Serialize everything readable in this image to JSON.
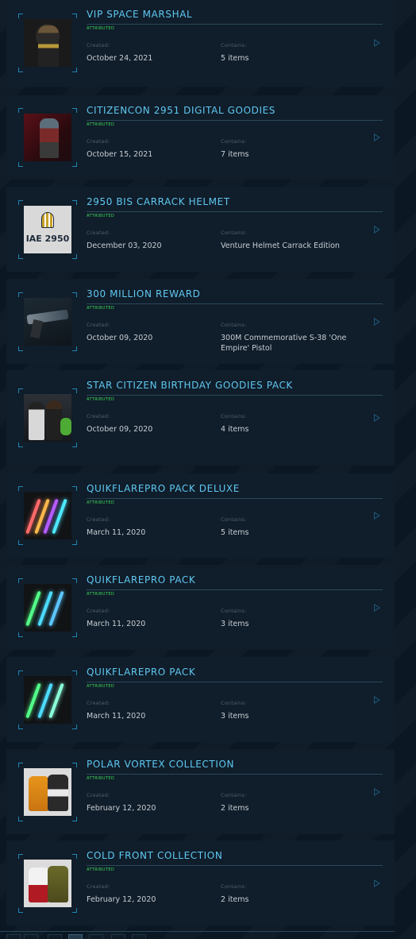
{
  "items": [
    {
      "title": "VIP SPACE MARSHAL",
      "status": "ATTRIBUTED",
      "created_label": "Created:",
      "created": "October 24, 2021",
      "contains_label": "Contains:",
      "contains": "5 items",
      "thumb": "marshal"
    },
    {
      "title": "CITIZENCON 2951 DIGITAL GOODIES",
      "status": "ATTRIBUTED",
      "created_label": "Created:",
      "created": "October 15, 2021",
      "contains_label": "Contains:",
      "contains": "7 items",
      "thumb": "cc"
    },
    {
      "title": "2950 BIS CARRACK HELMET",
      "status": "ATTRIBUTED",
      "created_label": "Created:",
      "created": "December 03, 2020",
      "contains_label": "Contains:",
      "contains": "Venture Helmet Carrack Edition",
      "thumb": "iae",
      "thumb_text": "IAE 2950"
    },
    {
      "title": "300 MILLION REWARD",
      "status": "ATTRIBUTED",
      "created_label": "Created:",
      "created": "October 09, 2020",
      "contains_label": "Contains:",
      "contains": "300M Commemorative S-38 'One Empire' Pistol",
      "thumb": "pistol"
    },
    {
      "title": "STAR CITIZEN BIRTHDAY GOODIES PACK",
      "status": "ATTRIBUTED",
      "created_label": "Created:",
      "created": "October 09, 2020",
      "contains_label": "Contains:",
      "contains": "4 items",
      "thumb": "bday"
    },
    {
      "title": "QUIKFLAREPRO PACK DELUXE",
      "status": "ATTRIBUTED",
      "created_label": "Created:",
      "created": "March 11, 2020",
      "contains_label": "Contains:",
      "contains": "5 items",
      "thumb": "flare5"
    },
    {
      "title": "QUIKFLAREPRO PACK",
      "status": "ATTRIBUTED",
      "created_label": "Created:",
      "created": "March 11, 2020",
      "contains_label": "Contains:",
      "contains": "3 items",
      "thumb": "flare3a"
    },
    {
      "title": "QUIKFLAREPRO PACK",
      "status": "ATTRIBUTED",
      "created_label": "Created:",
      "created": "March 11, 2020",
      "contains_label": "Contains:",
      "contains": "3 items",
      "thumb": "flare3b"
    },
    {
      "title": "POLAR VORTEX COLLECTION",
      "status": "ATTRIBUTED",
      "created_label": "Created:",
      "created": "February 12, 2020",
      "contains_label": "Contains:",
      "contains": "2 items",
      "thumb": "polar"
    },
    {
      "title": "COLD FRONT COLLECTION",
      "status": "ATTRIBUTED",
      "created_label": "Created:",
      "created": "February 12, 2020",
      "contains_label": "Contains:",
      "contains": "2 items",
      "thumb": "cold"
    }
  ],
  "colors": {
    "title": "#5ec8f1",
    "status": "#3fd95a",
    "value": "#c6ced4",
    "label": "#50606c",
    "background": "#0b1824",
    "card": "#101d2a"
  },
  "icons": {
    "open": "play-triangle-icon"
  }
}
